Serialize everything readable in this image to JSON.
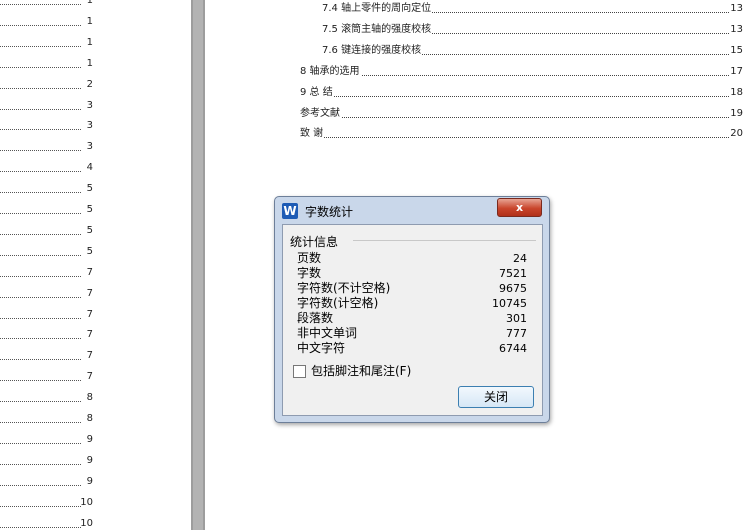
{
  "left_page": {
    "page_numbers": [
      "1",
      "1",
      "1",
      "1",
      "2",
      "3",
      "3",
      "3",
      "4",
      "5",
      "5",
      "5",
      "5",
      "7",
      "7",
      "7",
      "7",
      "7",
      "7",
      "8",
      "8",
      "9",
      "9",
      "9",
      "10",
      "10"
    ]
  },
  "right_page": {
    "toc": [
      {
        "title": "7.4  轴上零件的周向定位",
        "page": "13"
      },
      {
        "title": "7.5  滚筒主轴的强度校核",
        "page": "13"
      },
      {
        "title": "7.6  键连接的强度校核",
        "page": "15"
      },
      {
        "title": "8  轴承的选用",
        "page": "17"
      },
      {
        "title": "9  总   结",
        "page": "18"
      },
      {
        "title": "参考文献",
        "page": "19"
      },
      {
        "title": "致   谢",
        "page": "20"
      }
    ]
  },
  "dialog": {
    "icon": "W",
    "title": "字数统计",
    "close_icon": "x",
    "group_title": "统计信息",
    "stats": [
      {
        "label": "页数",
        "value": "24"
      },
      {
        "label": "字数",
        "value": "7521"
      },
      {
        "label": "字符数(不计空格)",
        "value": "9675"
      },
      {
        "label": "字符数(计空格)",
        "value": "10745"
      },
      {
        "label": "段落数",
        "value": "301"
      },
      {
        "label": "非中文单词",
        "value": "777"
      },
      {
        "label": "中文字符",
        "value": "6744"
      }
    ],
    "checkbox_label": "包括脚注和尾注(F)",
    "checkbox_checked": false,
    "close_button": "关闭"
  },
  "colors": {
    "dialog_frame": "#c9d7ea",
    "close_button": "#c9452c",
    "gutter": "#9d9d9d",
    "app_icon": "#1d5bb5"
  }
}
